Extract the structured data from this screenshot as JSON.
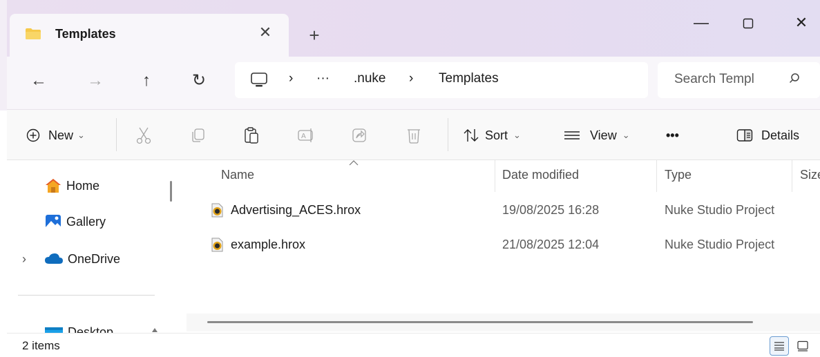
{
  "tab": {
    "title": "Templates",
    "close_glyph": "✕",
    "new_tab_glyph": "+"
  },
  "window": {
    "minimize_glyph": "—",
    "close_glyph": "✕"
  },
  "nav": {
    "back_glyph": "←",
    "forward_glyph": "→",
    "up_glyph": "↑",
    "refresh_glyph": "↻",
    "breadcrumb": [
      {
        "label": "›"
      },
      {
        "label": "···"
      },
      {
        "label": ".nuke"
      },
      {
        "label": "›"
      },
      {
        "label": "Templates"
      }
    ],
    "search_placeholder": "Search Templ"
  },
  "toolbar": {
    "new_label": "New",
    "sort_label": "Sort",
    "view_label": "View",
    "more_label": "•••",
    "details_label": "Details",
    "chevron": "⌄"
  },
  "sidebar": {
    "items": [
      {
        "label": "Home",
        "icon": "home-icon"
      },
      {
        "label": "Gallery",
        "icon": "gallery-icon"
      },
      {
        "label": "OneDrive",
        "icon": "onedrive-icon",
        "expand_glyph": "›"
      },
      {
        "label": "Desktop",
        "icon": "desktop-icon"
      }
    ]
  },
  "columns": {
    "name": "Name",
    "date": "Date modified",
    "type": "Type",
    "size": "Size"
  },
  "files": [
    {
      "name": "Advertising_ACES.hrox",
      "date": "19/08/2025 16:28",
      "type": "Nuke Studio Project"
    },
    {
      "name": "example.hrox",
      "date": "21/08/2025 12:04",
      "type": "Nuke Studio Project"
    }
  ],
  "status": {
    "item_count": "2 items"
  },
  "colors": {
    "accent": "#0067c0",
    "folder": "#f3c54b"
  }
}
